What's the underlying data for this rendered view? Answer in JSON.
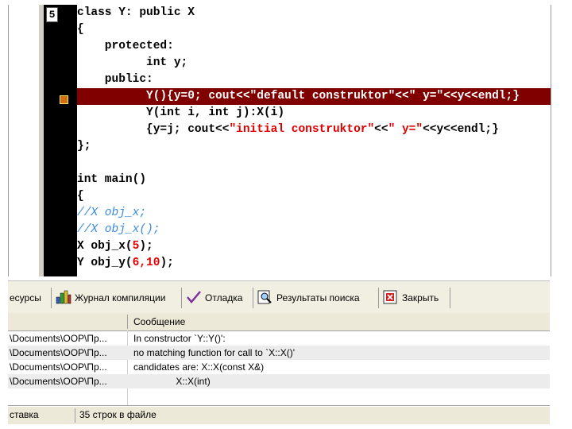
{
  "editor": {
    "current_line": "5",
    "lines": [
      {
        "text": "class Y: public X"
      },
      {
        "text": "{"
      },
      {
        "text": "    protected:"
      },
      {
        "text": "          int y;"
      },
      {
        "text": "    public:"
      },
      {
        "pre": "          Y(){y=0; cout<<",
        "str": "\"default construktor\"",
        "mid": "<<",
        "str2": "\" y=\"",
        "post": "<<y<<endl;}"
      },
      {
        "text": "          Y(int i, int j):X(i)"
      },
      {
        "pre": "          {y=j; cout<<",
        "str": "\"initial construktor\"",
        "mid": "<<",
        "str2": "\" y=\"",
        "post": "<<y<<endl;}"
      },
      {
        "text": "};"
      },
      {
        "text": ""
      },
      {
        "text": "int main()"
      },
      {
        "text": "{"
      },
      {
        "comment": "//X obj_x;"
      },
      {
        "comment": "//X obj_x();"
      },
      {
        "pre": "X obj_x(",
        "num": "5",
        "post": ");"
      },
      {
        "pre": "Y obj_y(",
        "num": "6,10",
        "post": ");"
      }
    ]
  },
  "tabs": [
    {
      "label": "есурсы",
      "icon": "resources-icon"
    },
    {
      "label": "Журнал компиляции",
      "icon": "compile-log-icon"
    },
    {
      "label": "Отладка",
      "icon": "debug-checkmark-icon"
    },
    {
      "label": "Результаты поиска",
      "icon": "search-results-icon"
    },
    {
      "label": "Закрыть",
      "icon": "close-icon"
    }
  ],
  "messages": {
    "header": "Сообщение",
    "rows": [
      {
        "file": "\\Documents\\OOP\\Пр...",
        "text": "In constructor `Y::Y()':"
      },
      {
        "file": "\\Documents\\OOP\\Пр...",
        "text": "no matching function for call to `X::X()'"
      },
      {
        "file": "\\Documents\\OOP\\Пр...",
        "text": "candidates are: X::X(const X&)"
      },
      {
        "file": "\\Documents\\OOP\\Пр...",
        "text": "                X::X(int)"
      }
    ]
  },
  "status": {
    "left": "ставка",
    "right": "35 строк в файле"
  },
  "colors": {
    "error_line_bg": "#800000",
    "string": "#e00000",
    "comment": "#3a8ae0",
    "gutter": "#000000"
  }
}
